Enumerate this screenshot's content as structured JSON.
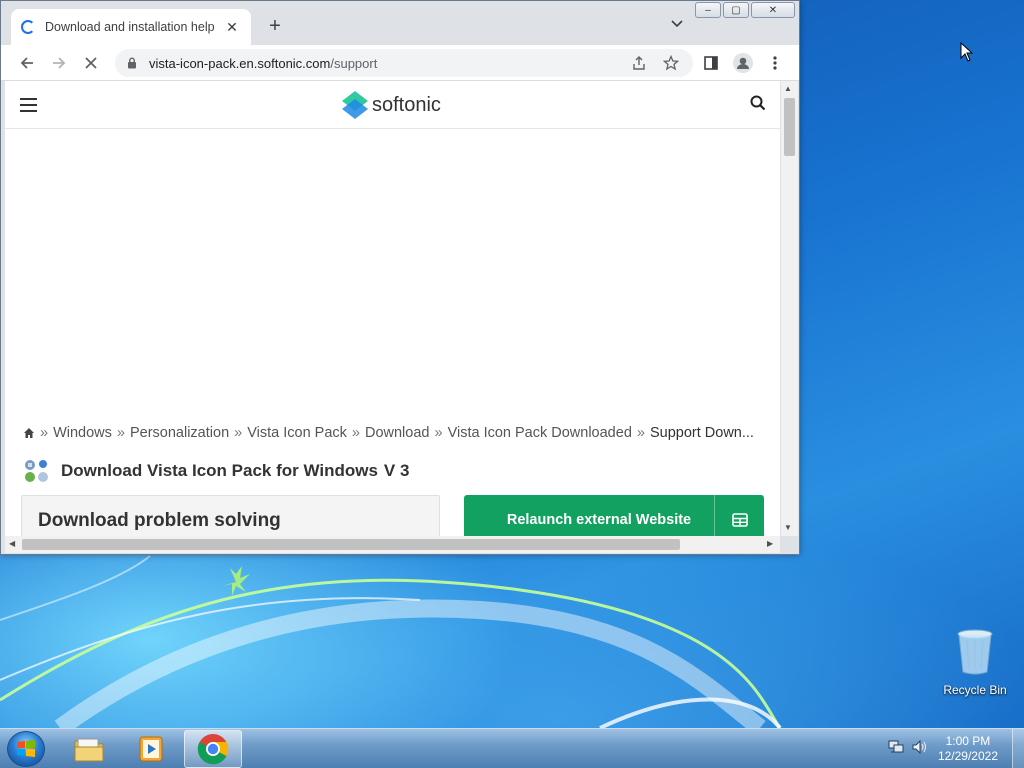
{
  "browser": {
    "tab": {
      "title": "Download and installation help",
      "close": "✕"
    },
    "new_tab": "+",
    "url": {
      "host": "vista-icon-pack.en.softonic.com",
      "path": "/support"
    },
    "caption_buttons": {
      "minimize": "–",
      "maximize": "▢",
      "close": "✕"
    }
  },
  "page": {
    "logo": "softonic",
    "breadcrumb": {
      "items": [
        "Windows",
        "Personalization",
        "Vista Icon Pack",
        "Download",
        "Vista Icon Pack Downloaded"
      ],
      "current": "Support Down...",
      "separator": "»"
    },
    "app_title": "Download Vista Icon Pack for Windows",
    "app_version": "V 3",
    "problem_title": "Download problem solving",
    "relaunch_label": "Relaunch external Website"
  },
  "desktop": {
    "recycle_bin_label": "Recycle Bin"
  },
  "taskbar": {
    "time": "1:00 PM",
    "date": "12/29/2022"
  },
  "colors": {
    "accent_green": "#12a160",
    "chrome_blue": "#1a73e8"
  }
}
